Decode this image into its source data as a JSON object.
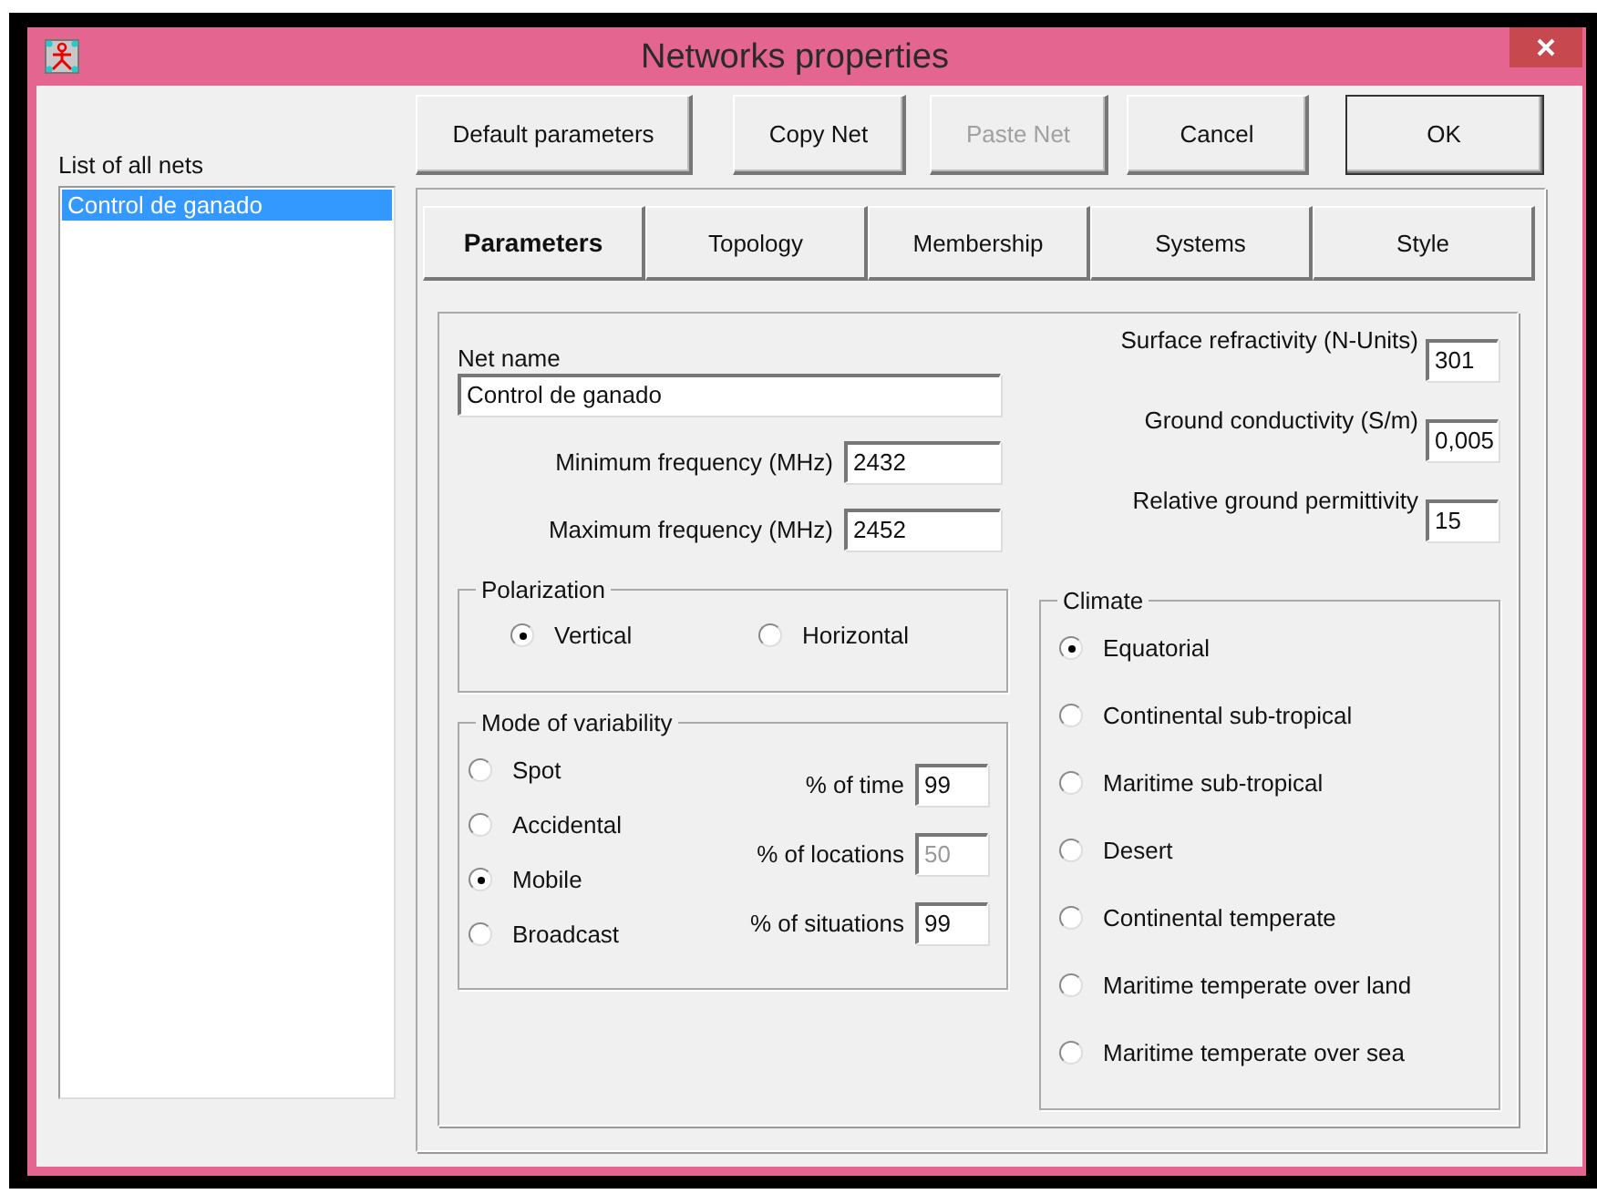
{
  "window": {
    "title": "Networks properties"
  },
  "net_list": {
    "label": "List of all nets",
    "items": [
      {
        "text": "Control de ganado",
        "selected": true
      }
    ]
  },
  "buttons": [
    {
      "label": "Default parameters",
      "disabled": false,
      "default": false
    },
    {
      "label": "Copy Net",
      "disabled": false,
      "default": false
    },
    {
      "label": "Paste Net",
      "disabled": true,
      "default": false
    },
    {
      "label": "Cancel",
      "disabled": false,
      "default": false
    },
    {
      "label": "OK",
      "disabled": false,
      "default": true
    }
  ],
  "tabs": [
    {
      "label": "Parameters",
      "selected": true
    },
    {
      "label": "Topology",
      "selected": false
    },
    {
      "label": "Membership",
      "selected": false
    },
    {
      "label": "Systems",
      "selected": false
    },
    {
      "label": "Style",
      "selected": false
    }
  ],
  "net_name": {
    "label": "Net name",
    "value": "Control de ganado"
  },
  "frequency_fields": [
    {
      "label": "Minimum frequency (MHz)",
      "value": "2432"
    },
    {
      "label": "Maximum frequency (MHz)",
      "value": "2452"
    }
  ],
  "polarization": {
    "title": "Polarization",
    "options": [
      {
        "label": "Vertical",
        "selected": true
      },
      {
        "label": "Horizontal",
        "selected": false
      }
    ]
  },
  "variability": {
    "title": "Mode of variability",
    "options": [
      {
        "label": "Spot",
        "selected": false
      },
      {
        "label": "Accidental",
        "selected": false
      },
      {
        "label": "Mobile",
        "selected": true
      },
      {
        "label": "Broadcast",
        "selected": false
      }
    ],
    "fields": [
      {
        "label": "% of time",
        "value": "99",
        "disabled": false
      },
      {
        "label": "% of locations",
        "value": "50",
        "disabled": true
      },
      {
        "label": "% of situations",
        "value": "99",
        "disabled": false
      }
    ]
  },
  "ground_fields": [
    {
      "label": "Surface refractivity (N-Units)",
      "value": "301"
    },
    {
      "label": "Ground conductivity (S/m)",
      "value": "0,005"
    },
    {
      "label": "Relative ground permittivity",
      "value": "15"
    }
  ],
  "climate": {
    "title": "Climate",
    "options": [
      {
        "label": "Equatorial",
        "selected": true
      },
      {
        "label": "Continental sub-tropical",
        "selected": false
      },
      {
        "label": "Maritime sub-tropical",
        "selected": false
      },
      {
        "label": "Desert",
        "selected": false
      },
      {
        "label": "Continental temperate",
        "selected": false
      },
      {
        "label": "Maritime temperate over land",
        "selected": false
      },
      {
        "label": "Maritime temperate over sea",
        "selected": false
      }
    ]
  }
}
